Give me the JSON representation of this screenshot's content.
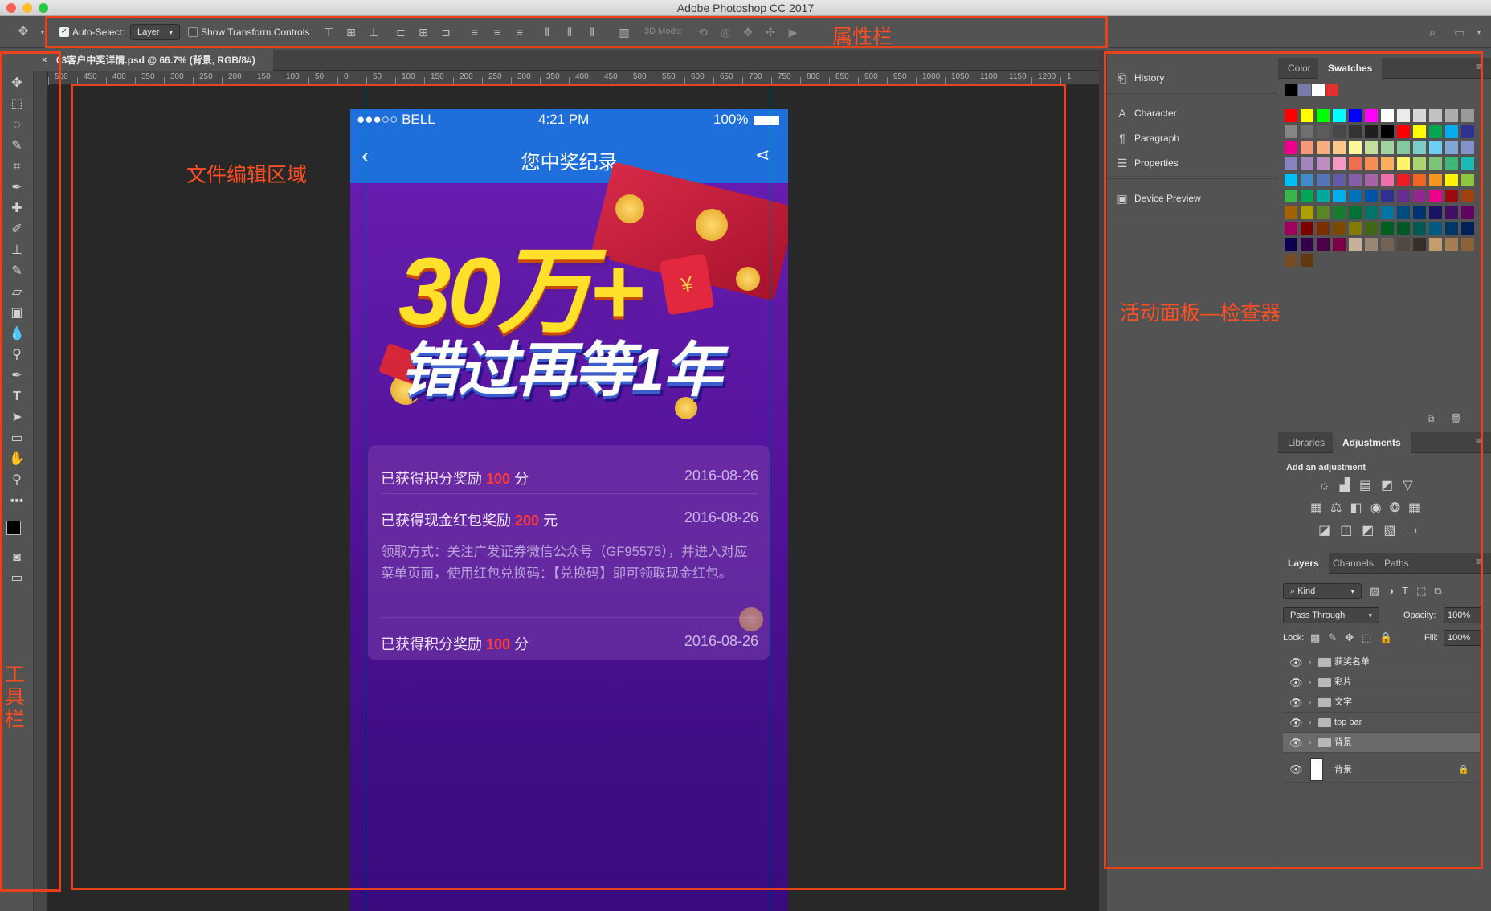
{
  "app": {
    "title": "Adobe Photoshop CC 2017"
  },
  "options_bar": {
    "auto_select_label": "Auto-Select:",
    "auto_select_value": "Layer",
    "transform_label": "Show Transform Controls",
    "mode_3d_label": "3D Mode:"
  },
  "document": {
    "tab_title": "03客户中奖详情.psd @ 66.7% (背景, RGB/8#)"
  },
  "ruler": {
    "labels": [
      "500",
      "450",
      "400",
      "350",
      "300",
      "250",
      "200",
      "150",
      "100",
      "50",
      "0",
      "50",
      "100",
      "150",
      "200",
      "250",
      "300",
      "350",
      "400",
      "450",
      "500",
      "550",
      "600",
      "650",
      "700",
      "750",
      "800",
      "850",
      "900",
      "950",
      "1000",
      "1050",
      "1100",
      "1150",
      "1200",
      "1"
    ]
  },
  "mobile": {
    "status_carrier": "●●●○○ BELL",
    "status_time": "4:21 PM",
    "status_battery": "100%",
    "nav_title": "您中奖纪录",
    "banner_line1": "30万+",
    "banner_line2": "错过再等1年",
    "rewards": [
      {
        "prefix": "已获得积分奖励 ",
        "amount": "100",
        "suffix": " 分",
        "date": "2016-08-26"
      },
      {
        "prefix": "已获得现金红包奖励 ",
        "amount": "200",
        "suffix": " 元",
        "date": "2016-08-26",
        "note": "领取方式：关注广发证券微信公众号（GF95575），并进入对应菜单页面，使用红包兑换码：【兑换码】即可领取现金红包。"
      },
      {
        "prefix": "已获得积分奖励 ",
        "amount": "100",
        "suffix": " 分",
        "date": "2016-08-26"
      }
    ]
  },
  "dock": {
    "items": [
      "History",
      "Character",
      "Paragraph",
      "Properties",
      "Device Preview"
    ]
  },
  "color_panel": {
    "tabs": [
      "Color",
      "Swatches"
    ],
    "recent": [
      "#000000",
      "#7a7aa8",
      "#ffffff",
      "#e03030"
    ],
    "swatches": [
      "#ff0000",
      "#ffff00",
      "#00ff00",
      "#00ffff",
      "#0000ff",
      "#ff00ff",
      "#ffffff",
      "#ebebeb",
      "#d6d6d6",
      "#c2c2c2",
      "#adadad",
      "#999999",
      "#858585",
      "#707070",
      "#5c5c5c",
      "#474747",
      "#333333",
      "#1f1f1f",
      "#000000",
      "#ff0000",
      "#ffff00",
      "#00a651",
      "#00aeef",
      "#2e3192",
      "#ec008c",
      "#f7977a",
      "#f9ad81",
      "#fdc68a",
      "#fff79a",
      "#c4df9b",
      "#a2d39c",
      "#82ca9d",
      "#7bcdc8",
      "#6ecff6",
      "#7ea7d8",
      "#8393ca",
      "#8882be",
      "#a187be",
      "#bc8dbf",
      "#f49ac2",
      "#f26c4f",
      "#f68e55",
      "#fbaf5c",
      "#fff467",
      "#acd372",
      "#7cc576",
      "#3bb878",
      "#1abbb4",
      "#00bff3",
      "#438cca",
      "#5574b9",
      "#605ca8",
      "#855fa8",
      "#a763a8",
      "#f06ea9",
      "#ed1c24",
      "#f26522",
      "#f7941d",
      "#fff200",
      "#8dc73f",
      "#39b54a",
      "#00a651",
      "#00a99d",
      "#00aeef",
      "#0072bc",
      "#0054a6",
      "#2e3192",
      "#662d91",
      "#92278f",
      "#ec008c",
      "#9e0b0f",
      "#a0410d",
      "#a36209",
      "#aba000",
      "#598527",
      "#1a7b30",
      "#007236",
      "#00746b",
      "#0076a3",
      "#004b80",
      "#003471",
      "#1b1464",
      "#440e62",
      "#630460",
      "#9e005d",
      "#790000",
      "#7b2e00",
      "#7d4900",
      "#827b00",
      "#406618",
      "#005e20",
      "#005826",
      "#005952",
      "#005b7f",
      "#003663",
      "#002157",
      "#0d004c",
      "#32004b",
      "#4b0049",
      "#7b0046",
      "#c7b299",
      "#998675",
      "#736357",
      "#534741",
      "#37302a",
      "#c69c6d",
      "#a67c52",
      "#8c6239",
      "#754c24",
      "#603913"
    ]
  },
  "adjustments_panel": {
    "tabs": [
      "Libraries",
      "Adjustments"
    ],
    "add_label": "Add an adjustment"
  },
  "layers_panel": {
    "tabs": [
      "Layers",
      "Channels",
      "Paths"
    ],
    "kind_label": "Kind",
    "blend_mode": "Pass Through",
    "opacity_label": "Opacity:",
    "opacity_value": "100%",
    "lock_label": "Lock:",
    "fill_label": "Fill:",
    "fill_value": "100%",
    "layers": [
      {
        "name": "获奖名单",
        "type": "group"
      },
      {
        "name": "彩片",
        "type": "group"
      },
      {
        "name": "文字",
        "type": "group"
      },
      {
        "name": "top bar",
        "type": "group"
      },
      {
        "name": "背景",
        "type": "group",
        "selected": true
      },
      {
        "name": "背景",
        "type": "layer"
      }
    ]
  },
  "annotations": {
    "options_bar": "属性栏",
    "canvas": "文件编辑区域",
    "panels": "活动面板—检查器",
    "toolbar": "工具栏"
  },
  "colors": {
    "accent": "#1e6fdc",
    "annotation": "#e8411c",
    "highlight": "#ff3a3a"
  }
}
